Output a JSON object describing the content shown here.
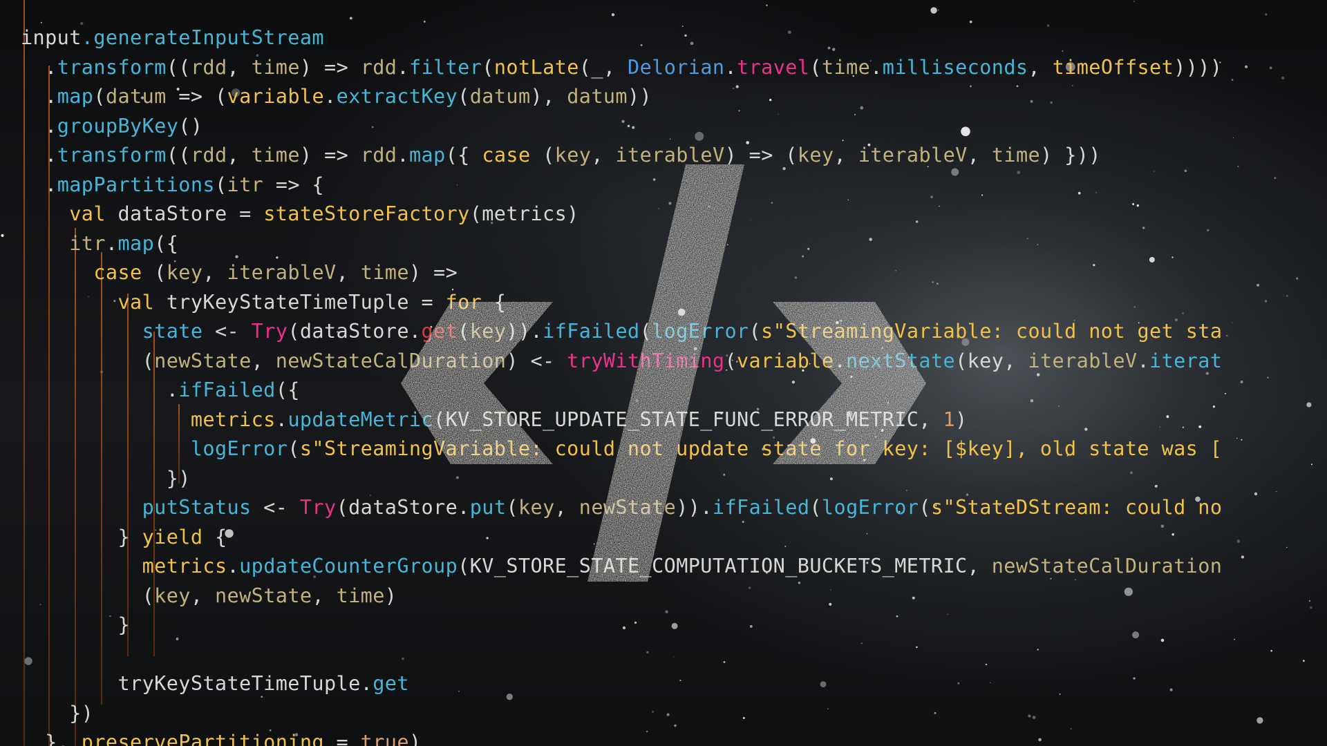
{
  "code_lines": [
    [
      [
        "input",
        "plain"
      ],
      [
        ".generateInputStream",
        "method"
      ]
    ],
    [
      [
        "  .",
        "plain"
      ],
      [
        "transform",
        "method"
      ],
      [
        "((",
        "plain"
      ],
      [
        "rdd",
        "param"
      ],
      [
        ", ",
        "plain"
      ],
      [
        "time",
        "param"
      ],
      [
        ") => ",
        "plain"
      ],
      [
        "rdd",
        "param"
      ],
      [
        ".",
        "plain"
      ],
      [
        "filter",
        "method"
      ],
      [
        "(",
        "plain"
      ],
      [
        "notLate",
        "func"
      ],
      [
        "(_, ",
        "plain"
      ],
      [
        "Delorian",
        "class"
      ],
      [
        ".",
        "plain"
      ],
      [
        "travel",
        "type"
      ],
      [
        "(",
        "plain"
      ],
      [
        "time",
        "param"
      ],
      [
        ".",
        "plain"
      ],
      [
        "milliseconds",
        "method"
      ],
      [
        ", ",
        "plain"
      ],
      [
        "timeOffset",
        "func"
      ],
      [
        "))))",
        "plain"
      ]
    ],
    [
      [
        "  .",
        "plain"
      ],
      [
        "map",
        "method"
      ],
      [
        "(",
        "plain"
      ],
      [
        "datum",
        "param"
      ],
      [
        " => (",
        "plain"
      ],
      [
        "variable",
        "func"
      ],
      [
        ".",
        "plain"
      ],
      [
        "extractKey",
        "method"
      ],
      [
        "(",
        "plain"
      ],
      [
        "datum",
        "param"
      ],
      [
        "), ",
        "plain"
      ],
      [
        "datum",
        "param"
      ],
      [
        "))",
        "plain"
      ]
    ],
    [
      [
        "  .",
        "plain"
      ],
      [
        "groupByKey",
        "method"
      ],
      [
        "()",
        "plain"
      ]
    ],
    [
      [
        "  .",
        "plain"
      ],
      [
        "transform",
        "method"
      ],
      [
        "((",
        "plain"
      ],
      [
        "rdd",
        "param"
      ],
      [
        ", ",
        "plain"
      ],
      [
        "time",
        "param"
      ],
      [
        ") => ",
        "plain"
      ],
      [
        "rdd",
        "param"
      ],
      [
        ".",
        "plain"
      ],
      [
        "map",
        "method"
      ],
      [
        "({ ",
        "plain"
      ],
      [
        "case",
        "keyword"
      ],
      [
        " (",
        "plain"
      ],
      [
        "key",
        "param"
      ],
      [
        ", ",
        "plain"
      ],
      [
        "iterableV",
        "param"
      ],
      [
        ") => (",
        "plain"
      ],
      [
        "key",
        "param"
      ],
      [
        ", ",
        "plain"
      ],
      [
        "iterableV",
        "param"
      ],
      [
        ", ",
        "plain"
      ],
      [
        "time",
        "param"
      ],
      [
        ") }))",
        "plain"
      ]
    ],
    [
      [
        "  .",
        "plain"
      ],
      [
        "mapPartitions",
        "method"
      ],
      [
        "(",
        "plain"
      ],
      [
        "itr",
        "param"
      ],
      [
        " => {",
        "plain"
      ]
    ],
    [
      [
        "    ",
        "plain"
      ],
      [
        "val",
        "keyword"
      ],
      [
        " dataStore = ",
        "plain"
      ],
      [
        "stateStoreFactory",
        "func"
      ],
      [
        "(metrics)",
        "plain"
      ]
    ],
    [
      [
        "    ",
        "plain"
      ],
      [
        "itr",
        "param"
      ],
      [
        ".",
        "plain"
      ],
      [
        "map",
        "method"
      ],
      [
        "({",
        "plain"
      ]
    ],
    [
      [
        "      ",
        "plain"
      ],
      [
        "case",
        "keyword"
      ],
      [
        " (",
        "plain"
      ],
      [
        "key",
        "param"
      ],
      [
        ", ",
        "plain"
      ],
      [
        "iterableV",
        "param"
      ],
      [
        ", ",
        "plain"
      ],
      [
        "time",
        "param"
      ],
      [
        ") =>",
        "plain"
      ]
    ],
    [
      [
        "        ",
        "plain"
      ],
      [
        "val",
        "keyword"
      ],
      [
        " tryKeyStateTimeTuple = ",
        "plain"
      ],
      [
        "for",
        "keyword"
      ],
      [
        " {",
        "plain"
      ]
    ],
    [
      [
        "          ",
        "plain"
      ],
      [
        "state",
        "method"
      ],
      [
        " <- ",
        "plain"
      ],
      [
        "Try",
        "type"
      ],
      [
        "(dataStore.",
        "plain"
      ],
      [
        "get",
        "red"
      ],
      [
        "(",
        "plain"
      ],
      [
        "key",
        "param"
      ],
      [
        ")).",
        "plain"
      ],
      [
        "ifFailed",
        "method"
      ],
      [
        "(",
        "plain"
      ],
      [
        "logError",
        "method"
      ],
      [
        "(",
        "plain"
      ],
      [
        "s\"StreamingVariable: could not get sta",
        "string"
      ]
    ],
    [
      [
        "          (",
        "plain"
      ],
      [
        "newState",
        "param"
      ],
      [
        ", ",
        "plain"
      ],
      [
        "newStateCalDuration",
        "param"
      ],
      [
        ") <- ",
        "plain"
      ],
      [
        "tryWithTiming",
        "type"
      ],
      [
        "(",
        "plain"
      ],
      [
        "variable",
        "func"
      ],
      [
        ".",
        "plain"
      ],
      [
        "nextState",
        "method"
      ],
      [
        "(key, ",
        "plain"
      ],
      [
        "iterableV",
        "param"
      ],
      [
        ".",
        "plain"
      ],
      [
        "iterat",
        "method"
      ]
    ],
    [
      [
        "            .",
        "plain"
      ],
      [
        "ifFailed",
        "method"
      ],
      [
        "({",
        "plain"
      ]
    ],
    [
      [
        "              ",
        "plain"
      ],
      [
        "metrics",
        "func"
      ],
      [
        ".",
        "plain"
      ],
      [
        "updateMetric",
        "method"
      ],
      [
        "(KV_STORE_UPDATE_STATE_FUNC_ERROR_METRIC, ",
        "plain"
      ],
      [
        "1",
        "lit"
      ],
      [
        ")",
        "plain"
      ]
    ],
    [
      [
        "              ",
        "plain"
      ],
      [
        "logError",
        "method"
      ],
      [
        "(",
        "plain"
      ],
      [
        "s\"StreamingVariable: could not update state for key: [$key], old state was [",
        "string"
      ]
    ],
    [
      [
        "            })",
        "plain"
      ]
    ],
    [
      [
        "          ",
        "plain"
      ],
      [
        "putStatus",
        "method"
      ],
      [
        " <- ",
        "plain"
      ],
      [
        "Try",
        "type"
      ],
      [
        "(dataStore.",
        "plain"
      ],
      [
        "put",
        "method"
      ],
      [
        "(",
        "plain"
      ],
      [
        "key",
        "param"
      ],
      [
        ", ",
        "plain"
      ],
      [
        "newState",
        "param"
      ],
      [
        ")).",
        "plain"
      ],
      [
        "ifFailed",
        "method"
      ],
      [
        "(",
        "plain"
      ],
      [
        "logError",
        "method"
      ],
      [
        "(",
        "plain"
      ],
      [
        "s\"StateDStream: could no",
        "string"
      ]
    ],
    [
      [
        "        } ",
        "plain"
      ],
      [
        "yield",
        "keyword"
      ],
      [
        " {",
        "plain"
      ]
    ],
    [
      [
        "          ",
        "plain"
      ],
      [
        "metrics",
        "func"
      ],
      [
        ".",
        "plain"
      ],
      [
        "updateCounterGroup",
        "method"
      ],
      [
        "(KV_STORE_STATE_COMPUTATION_BUCKETS_METRIC, ",
        "plain"
      ],
      [
        "newStateCalDuration",
        "param"
      ]
    ],
    [
      [
        "          (",
        "plain"
      ],
      [
        "key",
        "param"
      ],
      [
        ", ",
        "plain"
      ],
      [
        "newState",
        "param"
      ],
      [
        ", ",
        "plain"
      ],
      [
        "time",
        "param"
      ],
      [
        ")",
        "plain"
      ]
    ],
    [
      [
        "        }",
        "plain"
      ]
    ],
    [
      [
        "",
        "plain"
      ]
    ],
    [
      [
        "        tryKeyStateTimeTuple.",
        "plain"
      ],
      [
        "get",
        "method"
      ]
    ],
    [
      [
        "    })",
        "plain"
      ]
    ],
    [
      [
        "  }, ",
        "plain"
      ],
      [
        "preservePartitioning",
        "func"
      ],
      [
        " = ",
        "plain"
      ],
      [
        "true",
        "lit"
      ],
      [
        ")",
        "plain"
      ]
    ]
  ],
  "overlay_icon": "code-brackets-icon",
  "colors": {
    "method": "#46b6d6",
    "function": "#f0c24a",
    "param": "#c2b27e",
    "type": "#e8328a",
    "class": "#4f9be0",
    "guide": "#b45a14",
    "logo": "#ece8e2"
  }
}
